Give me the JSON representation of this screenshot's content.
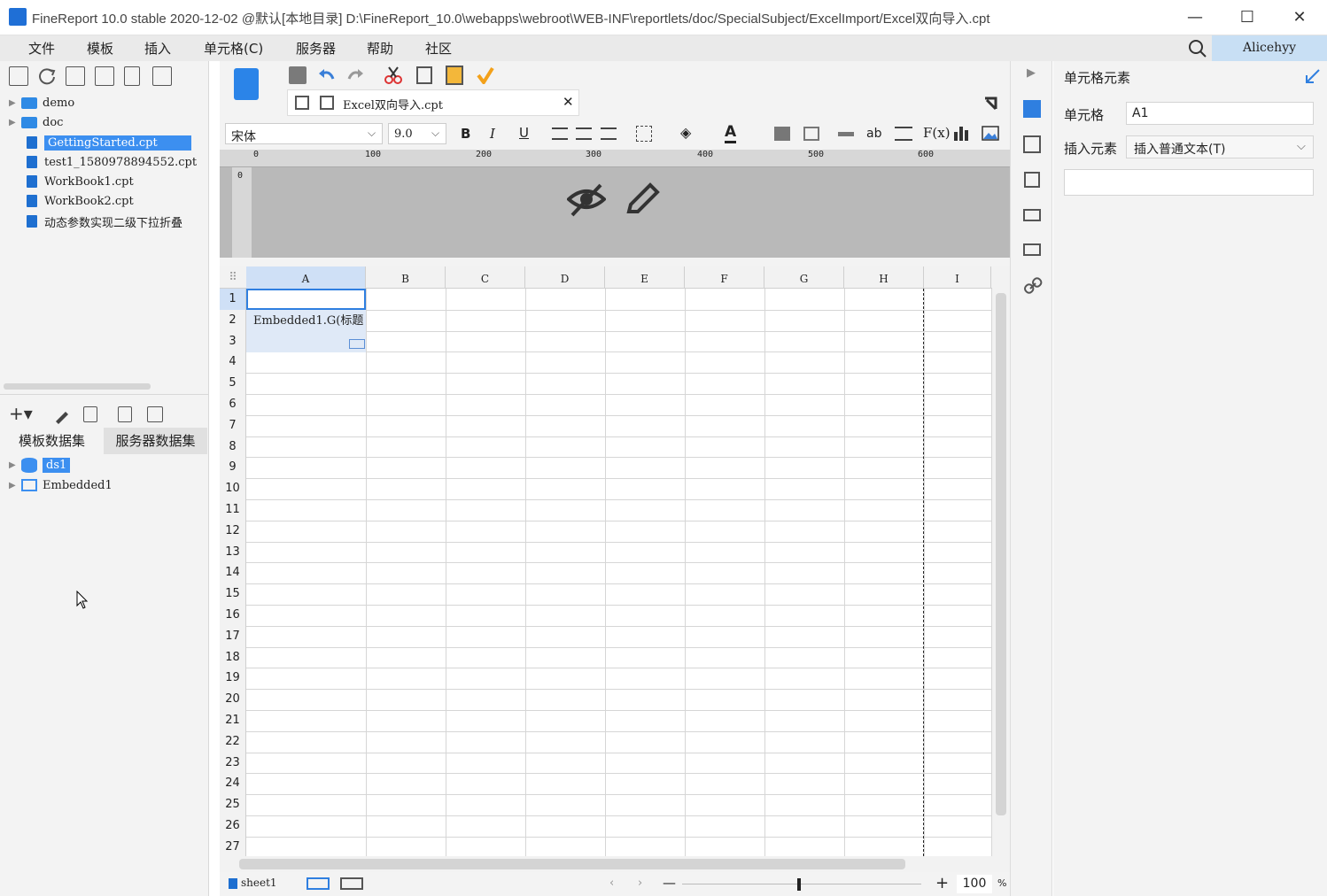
{
  "window": {
    "title": "FineReport 10.0 stable 2020-12-02 @默认[本地目录]    D:\\FineReport_10.0\\webapps\\webroot\\WEB-INF\\reportlets/doc/SpecialSubject/ExcelImport/Excel双向导入.cpt",
    "minimize": "—",
    "maximize": "☐",
    "close": "✕"
  },
  "menu": {
    "items": [
      "文件",
      "模板",
      "插入",
      "单元格(C)",
      "服务器",
      "帮助",
      "社区"
    ],
    "user": "Alicehyy"
  },
  "file_tree": {
    "items": [
      {
        "label": "demo",
        "type": "folder"
      },
      {
        "label": "doc",
        "type": "folder"
      },
      {
        "label": "GettingStarted.cpt",
        "type": "file",
        "selected": true
      },
      {
        "label": "test1_1580978894552.cpt",
        "type": "file"
      },
      {
        "label": "WorkBook1.cpt",
        "type": "file"
      },
      {
        "label": "WorkBook2.cpt",
        "type": "file"
      },
      {
        "label": "动态参数实现二级下拉折叠",
        "type": "file"
      }
    ]
  },
  "dataset": {
    "tabs": [
      "模板数据集",
      "服务器数据集"
    ],
    "items": [
      {
        "label": "ds1",
        "selected": true
      },
      {
        "label": "Embedded1"
      }
    ]
  },
  "editor": {
    "tab_title": "Excel双向导入.cpt",
    "font_name": "宋体",
    "font_size": "9.0",
    "ruler_ticks": [
      "0",
      "100",
      "200",
      "300",
      "400",
      "500",
      "600"
    ],
    "ruler_v": "0"
  },
  "sheet": {
    "columns": [
      "A",
      "B",
      "C",
      "D",
      "E",
      "F",
      "G",
      "H",
      "I"
    ],
    "rows": [
      "1",
      "2",
      "3",
      "4",
      "5",
      "6",
      "7",
      "8",
      "9",
      "10",
      "11",
      "12",
      "13",
      "14",
      "15",
      "16",
      "17",
      "18",
      "19",
      "20",
      "21",
      "22",
      "23",
      "24",
      "25",
      "26",
      "27"
    ],
    "cell_a2": "Embedded1.G(标题",
    "selected_cell": "A1"
  },
  "bottom": {
    "sheet_tab": "sheet1",
    "zoom": "100",
    "zoom_unit": "%",
    "zoom_minus": "—",
    "zoom_plus": "+"
  },
  "cell_element_panel": {
    "title": "单元格元素",
    "cell_label": "单元格",
    "cell_value": "A1",
    "insert_label": "插入元素",
    "insert_value": "插入普通文本(T)"
  },
  "colors": {
    "accent": "#3c8ff0",
    "menubar": "#eaeaea",
    "user_bg": "#c8dff4",
    "selection": "#2f7fe0"
  }
}
